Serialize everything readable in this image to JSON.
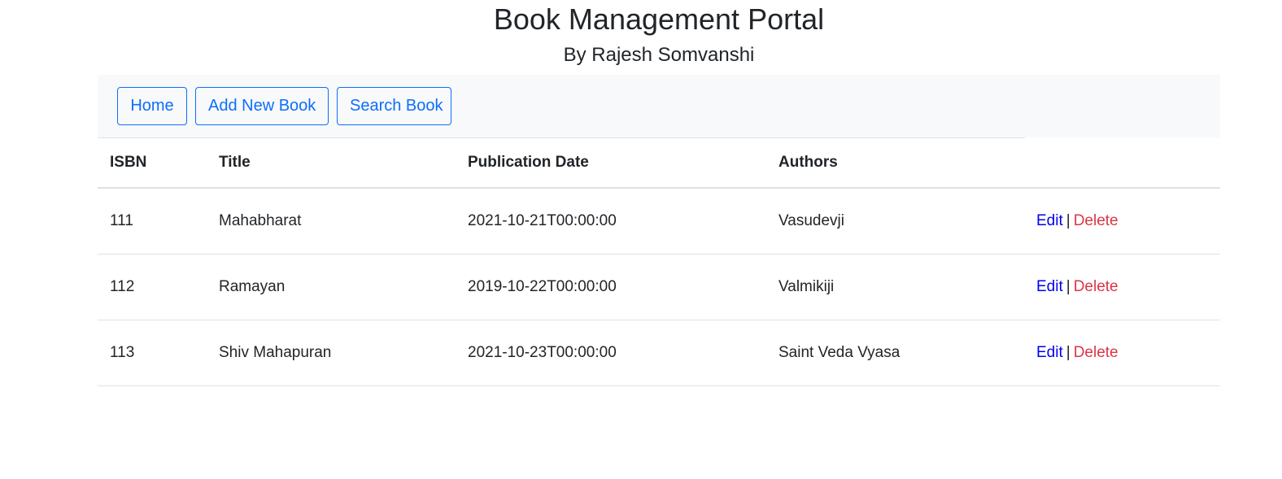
{
  "header": {
    "title": "Book Management Portal",
    "subtitle": "By Rajesh Somvanshi"
  },
  "nav": {
    "home": "Home",
    "add_new_book": "Add New Book",
    "search_book": "Search Book"
  },
  "table": {
    "columns": [
      "ISBN",
      "Title",
      "Publication Date",
      "Authors",
      ""
    ],
    "rows": [
      {
        "isbn": "111",
        "title": "Mahabharat",
        "publication_date": "2021-10-21T00:00:00",
        "authors": "Vasudevji"
      },
      {
        "isbn": "112",
        "title": "Ramayan",
        "publication_date": "2019-10-22T00:00:00",
        "authors": "Valmikiji"
      },
      {
        "isbn": "113",
        "title": "Shiv Mahapuran",
        "publication_date": "2021-10-23T00:00:00",
        "authors": "Saint Veda Vyasa"
      }
    ],
    "actions": {
      "edit": "Edit",
      "separator": "|",
      "delete": "Delete"
    }
  },
  "colors": {
    "primary": "#0d6efd",
    "edit_link": "#0000ee",
    "delete_link": "#dc3545",
    "navbar_bg": "#f8f9fa"
  }
}
